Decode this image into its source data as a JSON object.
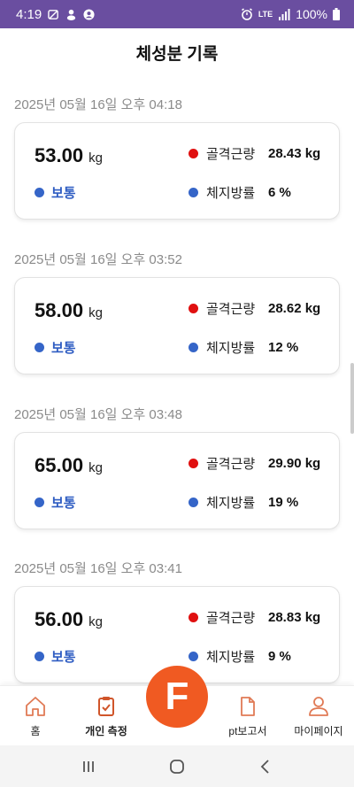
{
  "status_bar": {
    "time": "4:19",
    "battery": "100%",
    "network": "LTE"
  },
  "header": {
    "title": "체성분 기록"
  },
  "records": [
    {
      "date": "2025년 05월 16일 오후 04:18",
      "weight": "53.00",
      "weight_unit": "kg",
      "status": "보통",
      "muscle_label": "골격근량",
      "muscle_value": "28.43 kg",
      "fat_label": "체지방률",
      "fat_value": "6 %"
    },
    {
      "date": "2025년 05월 16일 오후 03:52",
      "weight": "58.00",
      "weight_unit": "kg",
      "status": "보통",
      "muscle_label": "골격근량",
      "muscle_value": "28.62 kg",
      "fat_label": "체지방률",
      "fat_value": "12 %"
    },
    {
      "date": "2025년 05월 16일 오후 03:48",
      "weight": "65.00",
      "weight_unit": "kg",
      "status": "보통",
      "muscle_label": "골격근량",
      "muscle_value": "29.90 kg",
      "fat_label": "체지방률",
      "fat_value": "19 %"
    },
    {
      "date": "2025년 05월 16일 오후 03:41",
      "weight": "56.00",
      "weight_unit": "kg",
      "status": "보통",
      "muscle_label": "골격근량",
      "muscle_value": "28.83 kg",
      "fat_label": "체지방률",
      "fat_value": "9 %"
    }
  ],
  "bottom_nav": {
    "items": [
      {
        "label": "홈",
        "icon": "home-icon"
      },
      {
        "label": "개인 측정",
        "icon": "clipboard-check-icon"
      },
      {
        "label": "pt보고서",
        "icon": "document-icon"
      },
      {
        "label": "마이페이지",
        "icon": "user-icon"
      }
    ],
    "fab_label": "F"
  },
  "colors": {
    "status_bar": "#6a4ea0",
    "accent": "#f05a22",
    "status_blue": "#3565c8",
    "muscle_red": "#e01010",
    "nav_icon": "#e07a55"
  }
}
